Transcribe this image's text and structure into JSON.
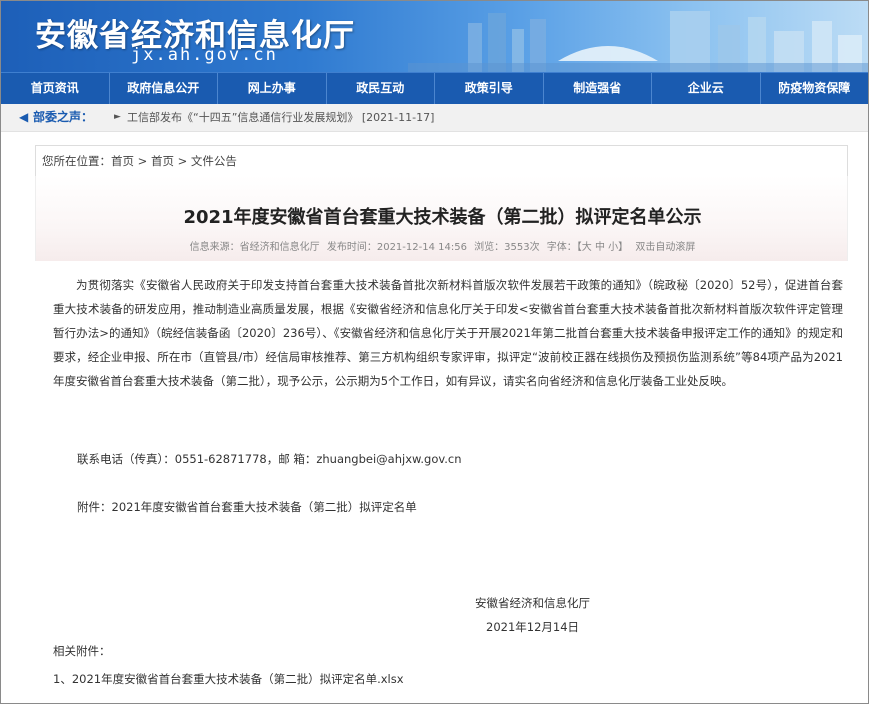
{
  "header": {
    "site_title": "安徽省经济和信息化厅",
    "site_domain": "jx.ah.gov.cn"
  },
  "nav": {
    "items": [
      {
        "label": "首页资讯"
      },
      {
        "label": "政府信息公开"
      },
      {
        "label": "网上办事"
      },
      {
        "label": "政民互动"
      },
      {
        "label": "政策引导"
      },
      {
        "label": "制造强省"
      },
      {
        "label": "企业云"
      },
      {
        "label": "防疫物资保障"
      }
    ]
  },
  "notice": {
    "label": "部委之声：",
    "text": "工信部发布《“十四五”信息通信行业发展规划》 [2021-11-17]"
  },
  "breadcrumb": {
    "text": "您所在位置：首页 > 首页 > 文件公告"
  },
  "article": {
    "title": "2021年度安徽省首台套重大技术装备（第二批）拟评定名单公示",
    "meta": {
      "source": "信息来源：省经济和信息化厅",
      "time": "发布时间：2021-12-14 14:56",
      "views": "浏览：3553次",
      "font": "字体：【大 中 小】",
      "scroll": "双击自动滚屏"
    },
    "paragraph": "为贯彻落实《安徽省人民政府关于印发支持首台套重大技术装备首批次新材料首版次软件发展若干政策的通知》（皖政秘〔2020〕52号），促进首台套重大技术装备的研发应用，推动制造业高质量发展，根据《安徽省经济和信息化厅关于印发<安徽省首台套重大技术装备首批次新材料首版次软件评定管理暂行办法>的通知》（皖经信装备函〔2020〕236号）、《安徽省经济和信息化厅关于开展2021年第二批首台套重大技术装备申报评定工作的通知》的规定和要求，经企业申报、所在市（直管县/市）经信局审核推荐、第三方机构组织专家评审，拟评定“波前校正器在线损伤及预损伤监测系统”等84项产品为2021年度安徽省首台套重大技术装备（第二批），现予公示，公示期为5个工作日，如有异议，请实名向省经济和信息化厅装备工业处反映。",
    "contact": "联系电话（传真）：0551-62871778，邮 箱：zhuangbei@ahjxw.gov.cn",
    "attachment": "附件：2021年度安徽省首台套重大技术装备（第二批）拟评定名单",
    "sign_org": "安徽省经济和信息化厅",
    "sign_date": "2021年12月14日",
    "related_label": "相关附件：",
    "related_file": "1、2021年度安徽省首台套重大技术装备（第二批）拟评定名单.xlsx"
  }
}
